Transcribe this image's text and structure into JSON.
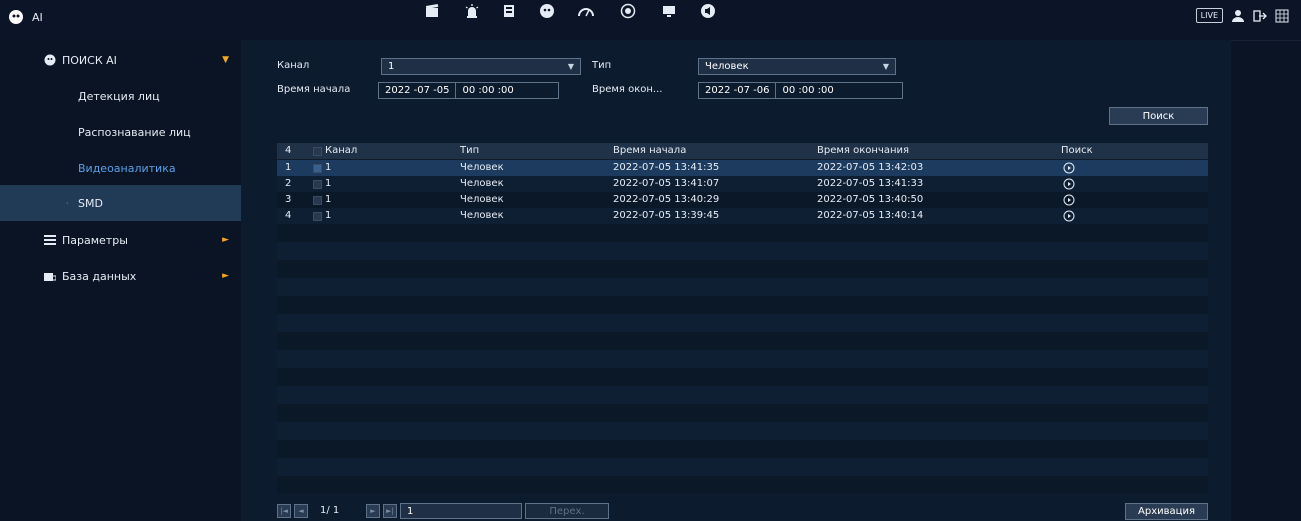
{
  "topbar": {
    "title": "AI",
    "live": "LIVE",
    "icons": [
      "ai-icon",
      "record-icon",
      "alarm-icon",
      "storage-icon",
      "face-icon",
      "gauge-icon",
      "target-icon",
      "monitor-icon",
      "audio-icon"
    ]
  },
  "sidebar": {
    "search_ai": "ПОИСК AI",
    "items": [
      {
        "label": "Детекция лиц"
      },
      {
        "label": "Распознавание лиц"
      },
      {
        "label": "Видеоаналитика"
      },
      {
        "label": "SMD"
      }
    ],
    "params": "Параметры",
    "db": "База данных"
  },
  "filters": {
    "channel_label": "Канал",
    "channel_value": "1",
    "type_label": "Тип",
    "type_value": "Человек",
    "start_label": "Время начала",
    "start_date": "2022 -07 -05",
    "start_time": "00 :00 :00",
    "end_label": "Время окон...",
    "end_date": "2022 -07 -06",
    "end_time": "00 :00 :00",
    "search_btn": "Поиск"
  },
  "table": {
    "count": "4",
    "columns": [
      "Канал",
      "Тип",
      "Время начала",
      "Время окончания",
      "Поиск"
    ],
    "rows": [
      {
        "idx": "1",
        "channel": "1",
        "type": "Человек",
        "start": "2022-07-05 13:41:35",
        "end": "2022-07-05 13:42:03"
      },
      {
        "idx": "2",
        "channel": "1",
        "type": "Человек",
        "start": "2022-07-05 13:41:07",
        "end": "2022-07-05 13:41:33"
      },
      {
        "idx": "3",
        "channel": "1",
        "type": "Человек",
        "start": "2022-07-05 13:40:29",
        "end": "2022-07-05 13:40:50"
      },
      {
        "idx": "4",
        "channel": "1",
        "type": "Человек",
        "start": "2022-07-05 13:39:45",
        "end": "2022-07-05 13:40:14"
      }
    ]
  },
  "pager": {
    "page": "1/ 1",
    "goto_value": "1",
    "goto_btn": "Перех.",
    "archive_btn": "Архивация"
  },
  "colors": {
    "accent": "#1c3b5e",
    "active_side": "#213a55",
    "orange": "#f5a623",
    "link": "#5aa0e6"
  }
}
